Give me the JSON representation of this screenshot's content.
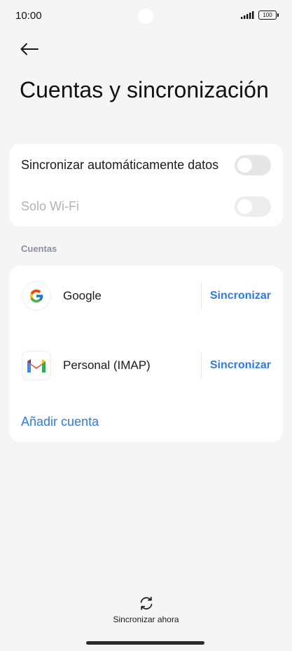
{
  "status_bar": {
    "time": "10:00",
    "battery": "100",
    "signal_icon": "signal-bars-icon"
  },
  "header": {
    "back_icon": "arrow-left-icon",
    "title": "Cuentas y sincronización"
  },
  "sync_settings": {
    "auto_sync": {
      "label": "Sincronizar automáticamente datos",
      "enabled": false
    },
    "wifi_only": {
      "label": "Solo Wi-Fi",
      "enabled": false,
      "disabled": true
    }
  },
  "accounts": {
    "section_title": "Cuentas",
    "items": [
      {
        "name": "Google",
        "icon": "google-icon",
        "action": "Sincronizar"
      },
      {
        "name": "Personal (IMAP)",
        "icon": "gmail-icon",
        "action": "Sincronizar"
      }
    ],
    "add_account": "Añadir cuenta"
  },
  "footer": {
    "sync_now_label": "Sincronizar ahora",
    "sync_icon": "sync-icon"
  },
  "colors": {
    "accent": "#2f7be5",
    "background": "#f5f5f5",
    "card": "#ffffff",
    "section_header": "#8a8fa0"
  }
}
